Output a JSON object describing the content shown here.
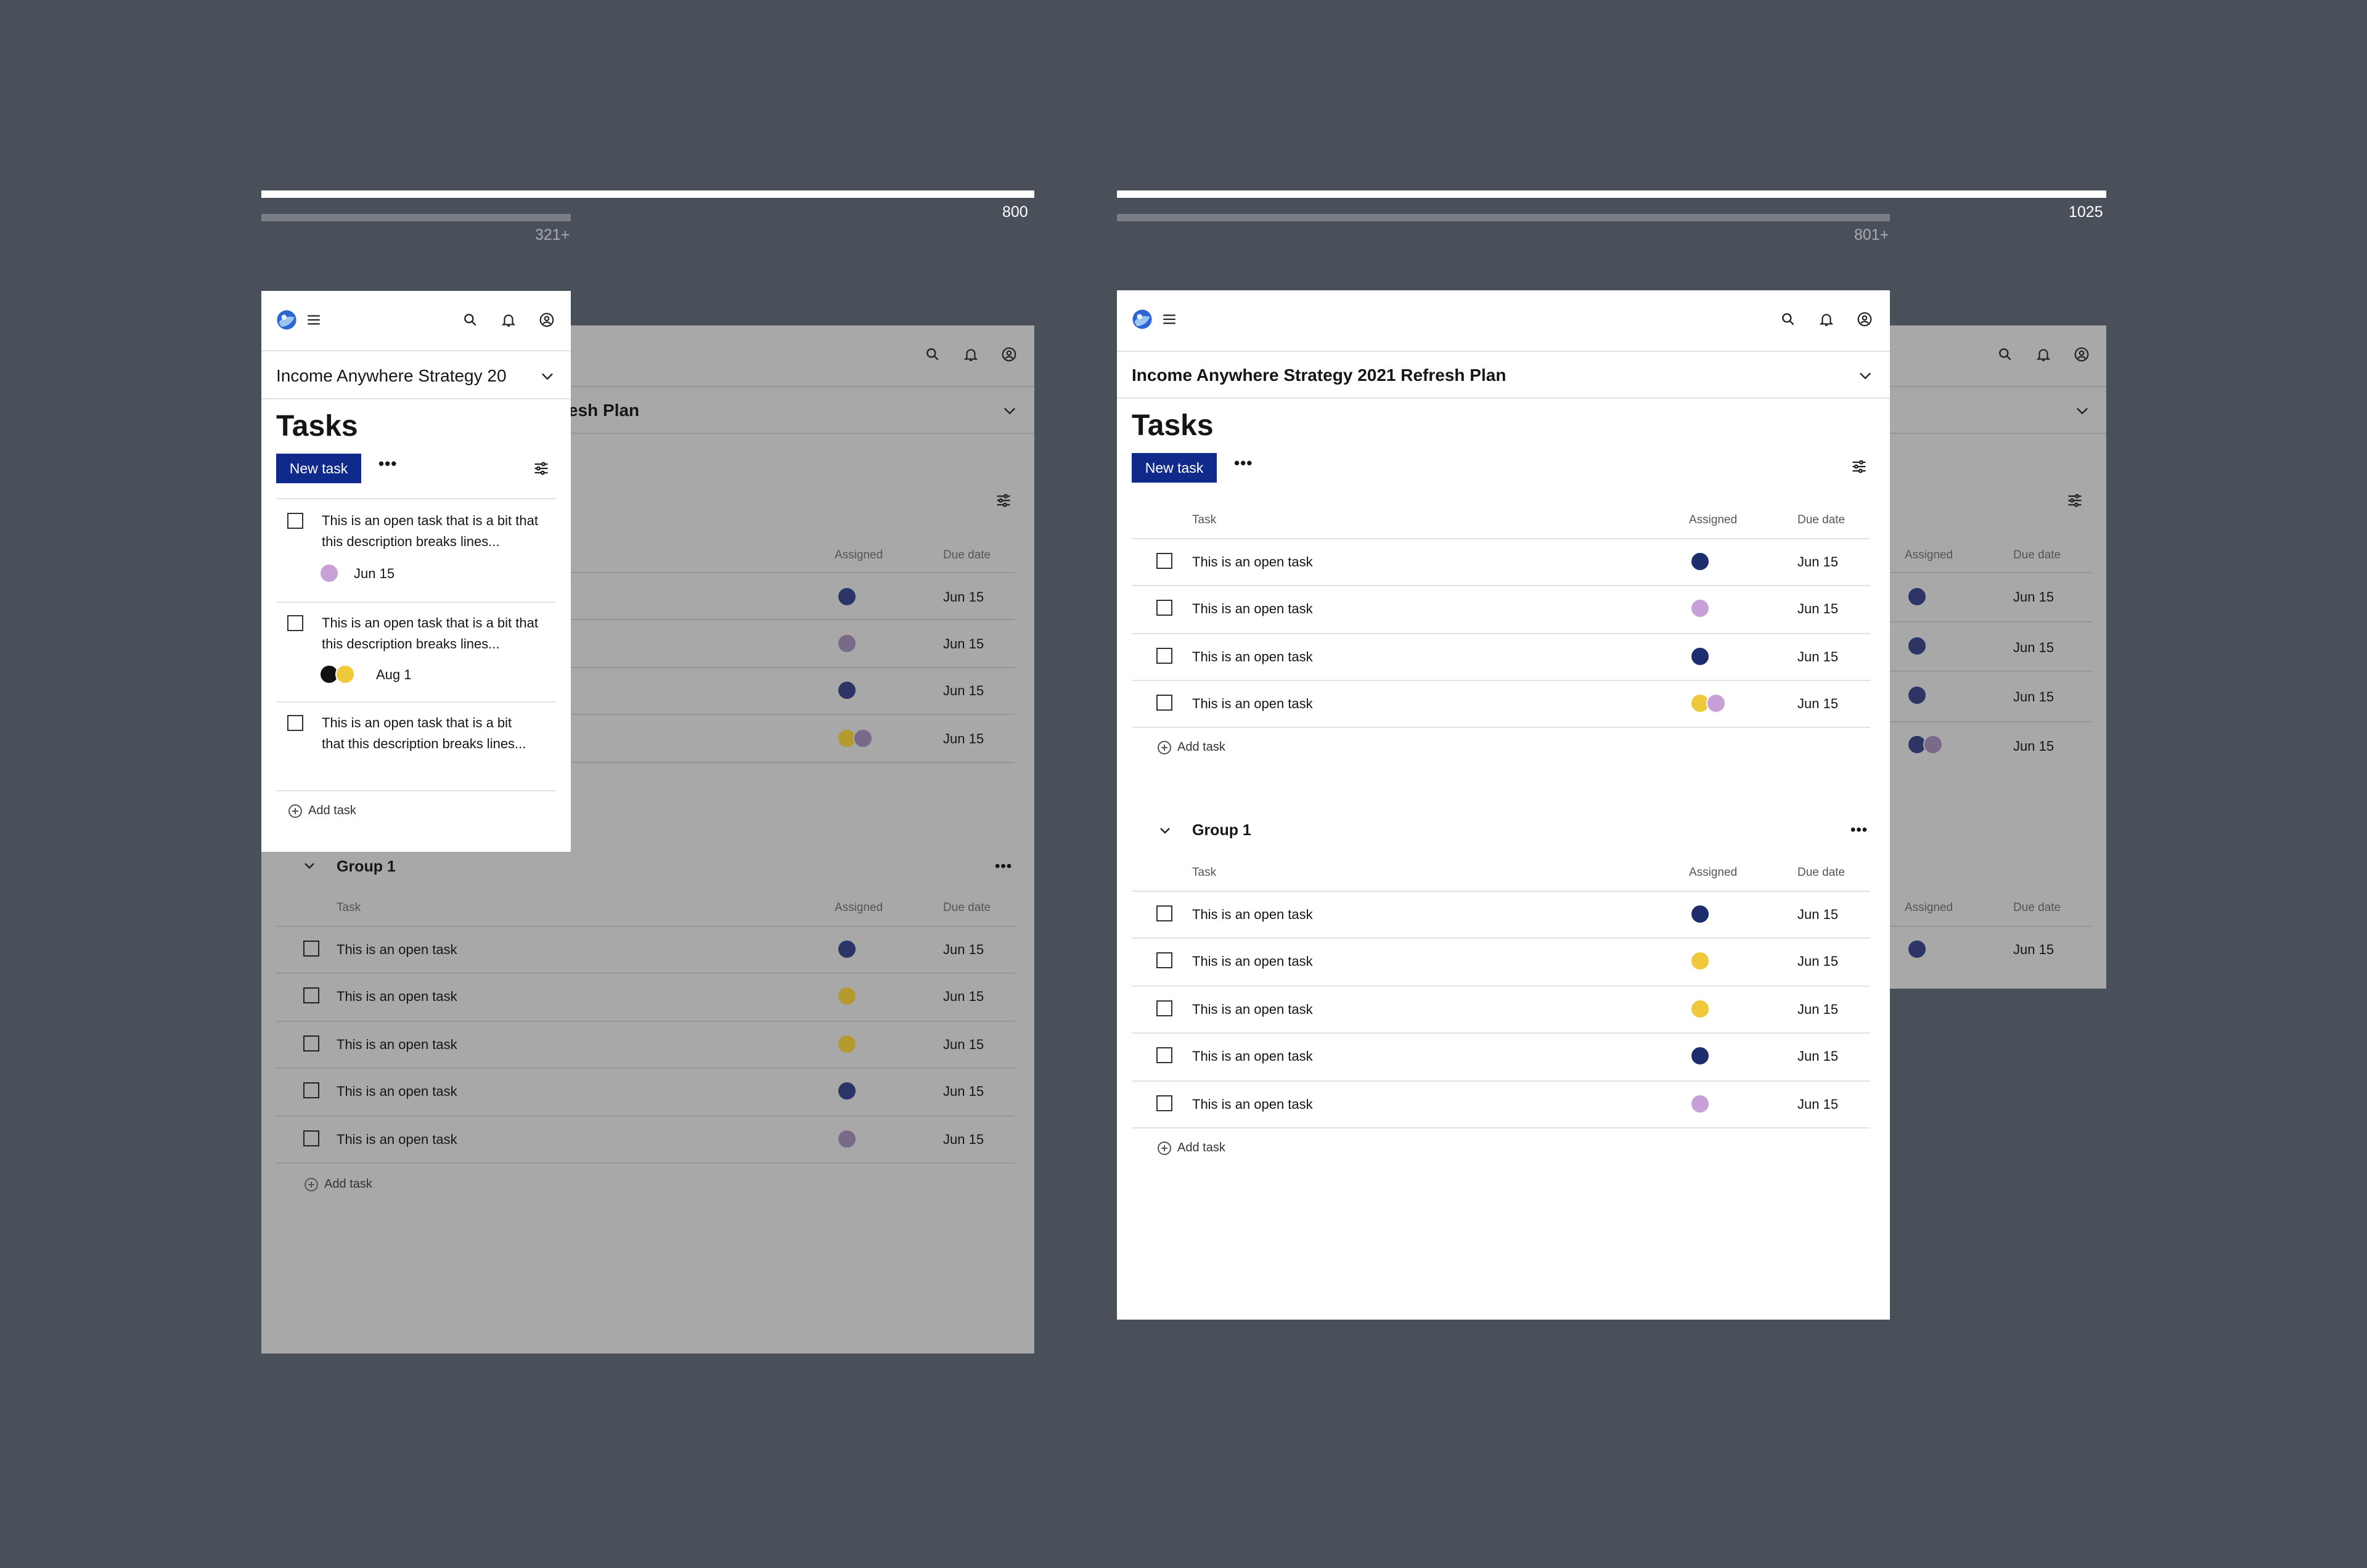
{
  "rulers": {
    "left": {
      "max_label": "800",
      "min_label": "321+"
    },
    "right": {
      "max_label": "1025",
      "min_label": "801+"
    }
  },
  "app": {
    "project_title": "Income Anywhere Strategy 2021 Refresh Plan",
    "project_title_truncated": "Income Anywhere Strategy 20",
    "project_title_tail": "esh Plan",
    "page_title": "Tasks",
    "new_task_label": "New task",
    "more_label": "•••",
    "add_task_label": "Add task",
    "columns": {
      "task": "Task",
      "assigned": "Assigned",
      "due": "Due date"
    },
    "group_name": "Group 1",
    "icons": [
      "logo-icon",
      "menu-icon",
      "search-icon",
      "bell-icon",
      "account-icon",
      "chevron-down-icon",
      "filter-icon",
      "plus-circle-icon"
    ]
  },
  "small_view": {
    "tasks": [
      {
        "text": "This is an open task that is a bit that this description breaks lines...",
        "date": "Jun 15"
      },
      {
        "text": "This is an open task that is a bit that this description breaks lines...",
        "date": "Aug 1"
      },
      {
        "text": "This is an open task that is a bit that this description breaks lines..."
      }
    ]
  },
  "medium_view": {
    "group0_tasks": [
      {
        "text": "This is an open task",
        "date": "Jun 15"
      },
      {
        "text": "This is an open task",
        "date": "Jun 15"
      },
      {
        "text": "This is an open task",
        "date": "Jun 15"
      },
      {
        "text": "This is an open task",
        "date": "Jun 15"
      }
    ],
    "group1_tasks": [
      {
        "text": "This is an open task",
        "date": "Jun 15"
      },
      {
        "text": "This is an open task",
        "date": "Jun 15"
      },
      {
        "text": "This is an open task",
        "date": "Jun 15"
      },
      {
        "text": "This is an open task",
        "date": "Jun 15"
      },
      {
        "text": "This is an open task",
        "date": "Jun 15"
      }
    ]
  },
  "colors": {
    "background": "#4a5059",
    "primary_button": "#0f2a8a",
    "ghost_frame": "#a8a8a8"
  }
}
